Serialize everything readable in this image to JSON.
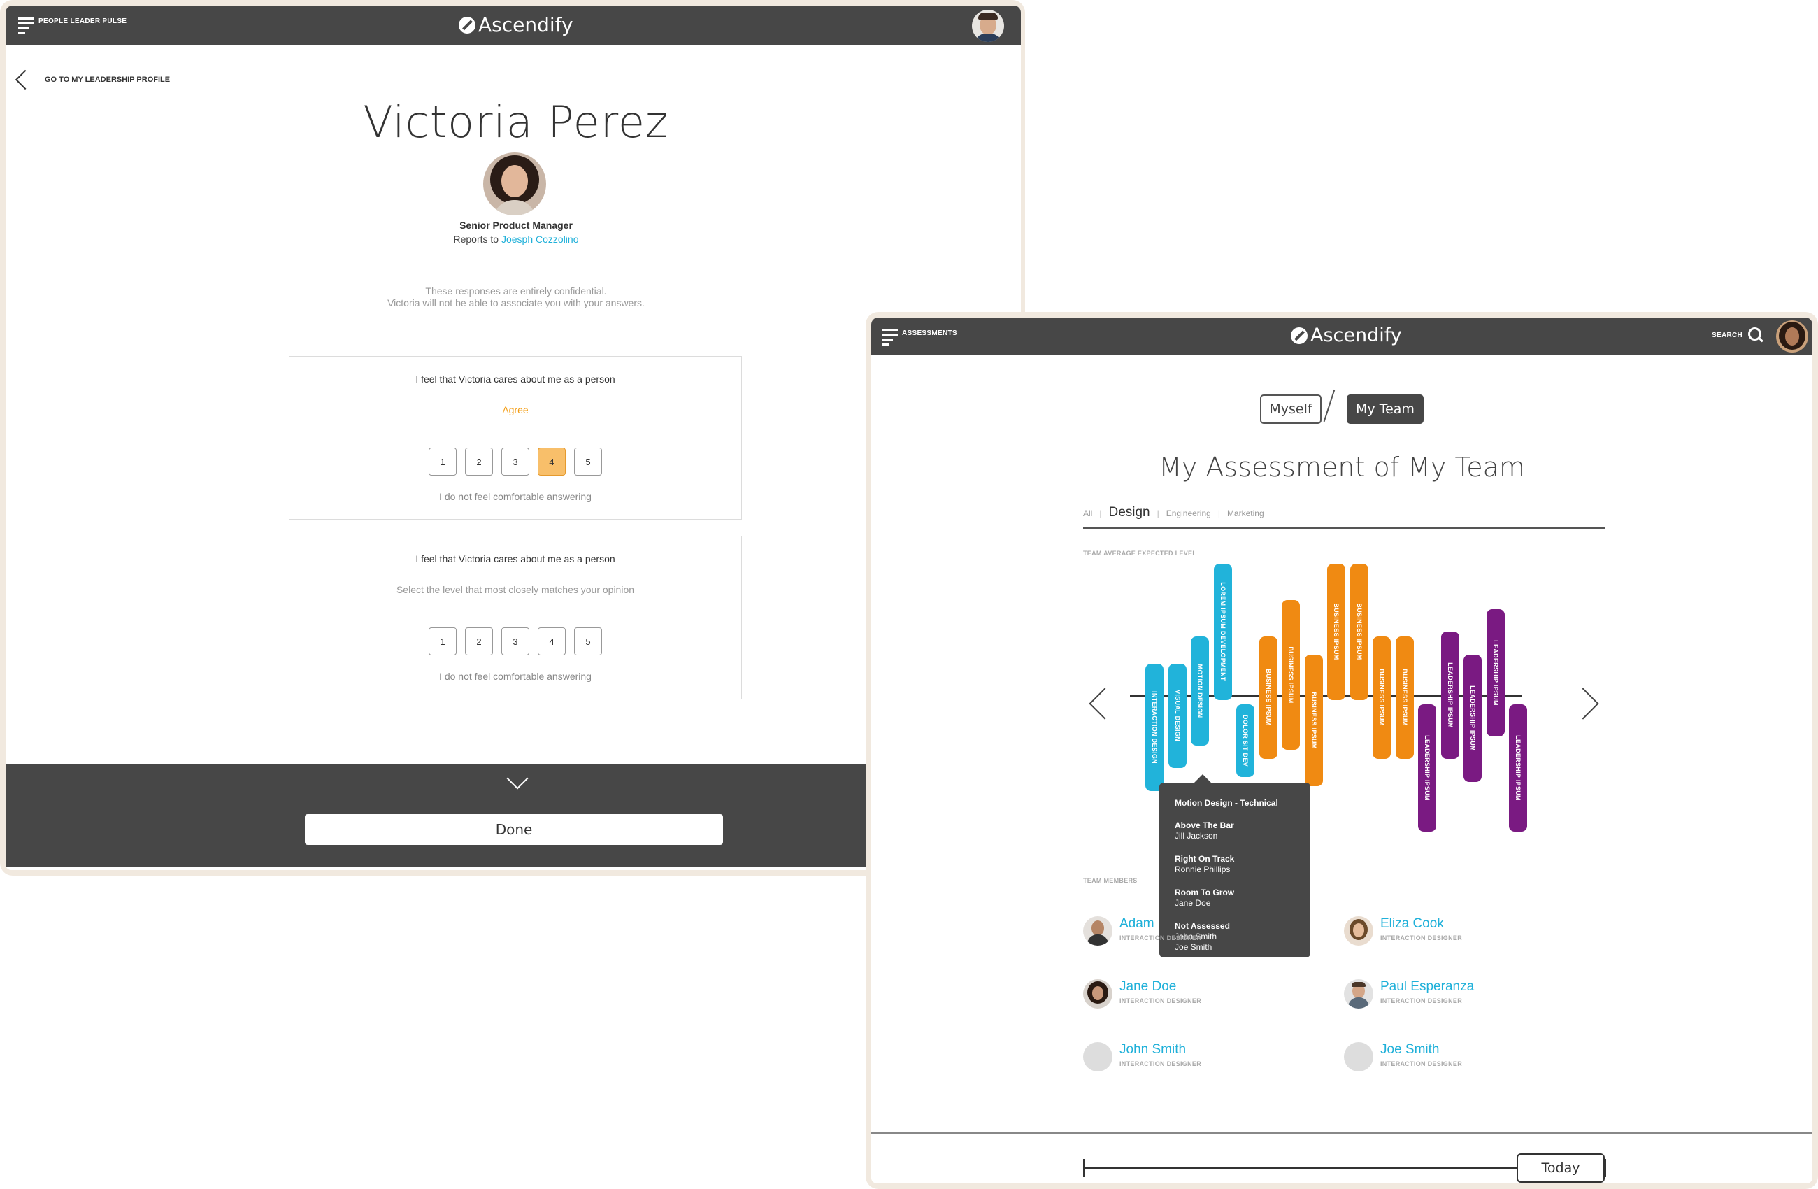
{
  "left_app": {
    "topbar": {
      "section_label": "PEOPLE LEADER PULSE",
      "logo_text": "Ascendify"
    },
    "back_link": "GO TO MY LEADERSHIP PROFILE",
    "person": {
      "name": "Victoria Perez",
      "title": "Senior Product Manager",
      "reports_to_prefix": "Reports to",
      "reports_to_name": "Joesph Cozzolino"
    },
    "confidential_line1": "These responses are entirely confidential.",
    "confidential_line2": "Victoria will not be able to associate you with your answers.",
    "questions": [
      {
        "text": "I feel that Victoria cares about me as a person",
        "answer": "Agree",
        "options": [
          "1",
          "2",
          "3",
          "4",
          "5"
        ],
        "selected": "4",
        "opt_out": "I do not feel comfortable answering"
      },
      {
        "text": "I feel that Victoria cares about me as a person",
        "answer": "Select the level that most closely matches your opinion",
        "options": [
          "1",
          "2",
          "3",
          "4",
          "5"
        ],
        "selected": null,
        "opt_out": "I do not feel comfortable answering"
      }
    ],
    "done_label": "Done"
  },
  "right_app": {
    "topbar": {
      "section_label": "ASSESSMENTS",
      "logo_text": "Ascendify",
      "search_label": "SEARCH"
    },
    "toggle": {
      "myself": "Myself",
      "my_team": "My Team",
      "active": "My Team"
    },
    "title": "My Assessment of My Team",
    "filters": [
      {
        "label": "All",
        "active": false
      },
      {
        "label": "Design",
        "active": true
      },
      {
        "label": "Engineering",
        "active": false
      },
      {
        "label": "Marketing",
        "active": false
      }
    ],
    "team_avg_label": "TEAM AVERAGE EXPECTED LEVEL",
    "chart_data": {
      "type": "bar",
      "description_axis": "above/below expected level",
      "categories": [
        "INTERACTION DESIGN",
        "VISUAL DESIGN",
        "MOTION DESIGN",
        "LOREM IPSUM DEVELOPMENT",
        "DOLOR SIT DEV",
        "BUSINESS IPSUM",
        "BUSINESS IPSUM",
        "BUSINESS IPSUM",
        "BUSINESS IPSUM",
        "BUSINESS IPSUM",
        "BUSINESS IPSUM",
        "BUSINESS IPSUM",
        "LEADERSHIP IPSUM",
        "LEADERSHIP IPSUM",
        "LEADERSHIP IPSUM",
        "LEADERSHIP IPSUM",
        "LEADERSHIP IPSUM"
      ],
      "series": [
        {
          "color": "#21b3da",
          "indices": [
            0,
            1,
            2,
            3,
            4
          ]
        },
        {
          "color": "#f08a12",
          "indices": [
            5,
            6,
            7,
            8,
            9,
            10,
            11
          ]
        },
        {
          "color": "#7a1a82",
          "indices": [
            12,
            13,
            14,
            15,
            16
          ]
        }
      ],
      "bars": [
        {
          "label": "INTERACTION DESIGN",
          "top": -0.7,
          "bottom": 2.1,
          "color": "#21b3da"
        },
        {
          "label": "VISUAL DESIGN",
          "top": -0.7,
          "bottom": 1.6,
          "color": "#21b3da"
        },
        {
          "label": "MOTION DESIGN",
          "top": -1.3,
          "bottom": 1.1,
          "color": "#21b3da"
        },
        {
          "label": "LOREM IPSUM DEVELOPMENT",
          "top": -2.9,
          "bottom": 0.1,
          "color": "#21b3da"
        },
        {
          "label": "DOLOR SIT DEV",
          "top": 0.2,
          "bottom": 1.8,
          "color": "#21b3da"
        },
        {
          "label": "BUSINESS IPSUM",
          "top": -1.3,
          "bottom": 1.4,
          "color": "#f08a12"
        },
        {
          "label": "BUSINESS IPSUM",
          "top": -2.1,
          "bottom": 1.2,
          "color": "#f08a12"
        },
        {
          "label": "BUSINESS IPSUM",
          "top": -0.9,
          "bottom": 2.0,
          "color": "#f08a12"
        },
        {
          "label": "BUSINESS IPSUM",
          "top": -2.9,
          "bottom": 0.1,
          "color": "#f08a12"
        },
        {
          "label": "BUSINESS IPSUM",
          "top": -2.9,
          "bottom": 0.1,
          "color": "#f08a12"
        },
        {
          "label": "BUSINESS IPSUM",
          "top": -1.3,
          "bottom": 1.4,
          "color": "#f08a12"
        },
        {
          "label": "BUSINESS IPSUM",
          "top": -1.3,
          "bottom": 1.4,
          "color": "#f08a12"
        },
        {
          "label": "LEADERSHIP IPSUM",
          "top": 0.2,
          "bottom": 3.0,
          "color": "#7a1a82"
        },
        {
          "label": "LEADERSHIP IPSUM",
          "top": -1.4,
          "bottom": 1.4,
          "color": "#7a1a82"
        },
        {
          "label": "LEADERSHIP IPSUM",
          "top": -0.9,
          "bottom": 1.9,
          "color": "#7a1a82"
        },
        {
          "label": "LEADERSHIP IPSUM",
          "top": -1.9,
          "bottom": 0.9,
          "color": "#7a1a82"
        },
        {
          "label": "LEADERSHIP IPSUM",
          "top": 0.2,
          "bottom": 3.0,
          "color": "#7a1a82"
        }
      ],
      "ylim": [
        -3,
        3
      ]
    },
    "tooltip": {
      "title": "Motion Design - Technical",
      "groups": [
        {
          "heading": "Above The Bar",
          "people": [
            "Jill Jackson"
          ]
        },
        {
          "heading": "Right On Track",
          "people": [
            "Ronnie Phillips"
          ]
        },
        {
          "heading": "Room To Grow",
          "people": [
            "Jane Doe"
          ]
        },
        {
          "heading": "Not Assessed",
          "people": [
            "John Smith",
            "Joe Smith"
          ]
        }
      ]
    },
    "team_members_label": "TEAM MEMBERS",
    "members": [
      {
        "name": "Adam",
        "role": "INTERACTION DESIGNER"
      },
      {
        "name": "Eliza Cook",
        "role": "INTERACTION DESIGNER"
      },
      {
        "name": "Jane Doe",
        "role": "INTERACTION DESIGNER"
      },
      {
        "name": "Paul Esperanza",
        "role": "INTERACTION DESIGNER"
      },
      {
        "name": "John Smith",
        "role": "INTERACTION DESIGNER"
      },
      {
        "name": "Joe Smith",
        "role": "INTERACTION DESIGNER"
      }
    ],
    "today_label": "Today"
  },
  "colors": {
    "topbar": "#474747",
    "accent_blue": "#21b3da",
    "accent_orange": "#f08a12",
    "accent_purple": "#7a1a82",
    "selected_fill": "#f8bf6a",
    "frame": "#f1e9df"
  }
}
